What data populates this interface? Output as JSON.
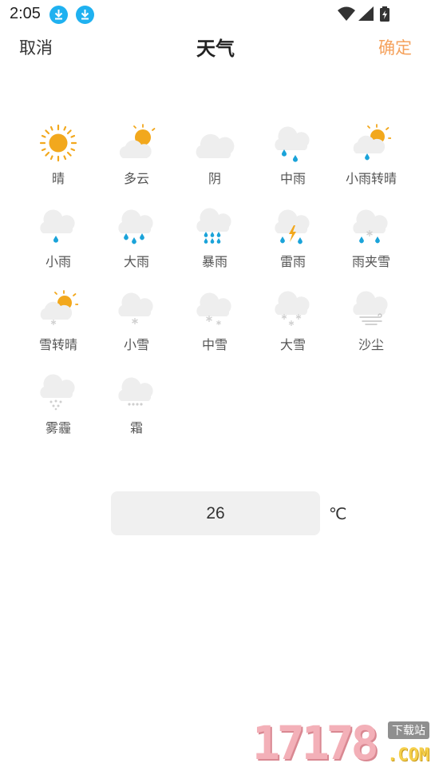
{
  "status_bar": {
    "time": "2:05"
  },
  "header": {
    "cancel_label": "取消",
    "title": "天气",
    "confirm_label": "确定"
  },
  "colors": {
    "accent": "#f5a25d",
    "sun": "#f2a81d",
    "rain": "#1aa3d9",
    "cloud": "#eeeeee"
  },
  "weather_options": [
    {
      "label": "晴",
      "icon": "sunny-icon"
    },
    {
      "label": "多云",
      "icon": "partly-cloudy-icon"
    },
    {
      "label": "阴",
      "icon": "overcast-icon"
    },
    {
      "label": "中雨",
      "icon": "moderate-rain-icon"
    },
    {
      "label": "小雨转晴",
      "icon": "light-rain-to-sunny-icon"
    },
    {
      "label": "小雨",
      "icon": "light-rain-icon"
    },
    {
      "label": "大雨",
      "icon": "heavy-rain-icon"
    },
    {
      "label": "暴雨",
      "icon": "rainstorm-icon"
    },
    {
      "label": "雷雨",
      "icon": "thunderstorm-icon"
    },
    {
      "label": "雨夹雪",
      "icon": "sleet-icon"
    },
    {
      "label": "雪转晴",
      "icon": "snow-to-sunny-icon"
    },
    {
      "label": "小雪",
      "icon": "light-snow-icon"
    },
    {
      "label": "中雪",
      "icon": "moderate-snow-icon"
    },
    {
      "label": "大雪",
      "icon": "heavy-snow-icon"
    },
    {
      "label": "沙尘",
      "icon": "sandstorm-icon"
    },
    {
      "label": "雾霾",
      "icon": "haze-icon"
    },
    {
      "label": "霜",
      "icon": "frost-icon"
    }
  ],
  "temperature": {
    "value": "26",
    "unit": "℃"
  },
  "watermark": {
    "number": "17178",
    "tag": "下载站",
    "domain": ".COM"
  }
}
